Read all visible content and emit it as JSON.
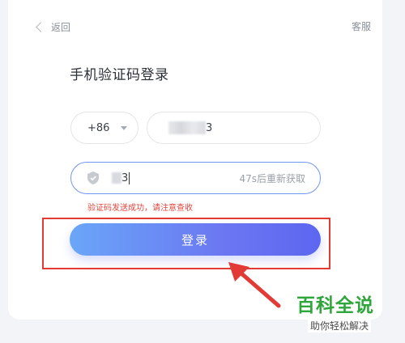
{
  "header": {
    "back_label": "返回",
    "service_label": "客服"
  },
  "title": "手机验证码登录",
  "phone": {
    "country_code": "+86",
    "value_visible": "3"
  },
  "code": {
    "value_visible": "3",
    "resend_label": "47s后重新获取"
  },
  "message": "验证码发送成功，请注意查收",
  "login_button": "登录",
  "watermark": {
    "title": "百科全说",
    "subtitle": "助你轻松解决"
  },
  "colors": {
    "accent": "#6b78f2",
    "error": "#e23a34",
    "watermark_green": "#2fa63b"
  }
}
